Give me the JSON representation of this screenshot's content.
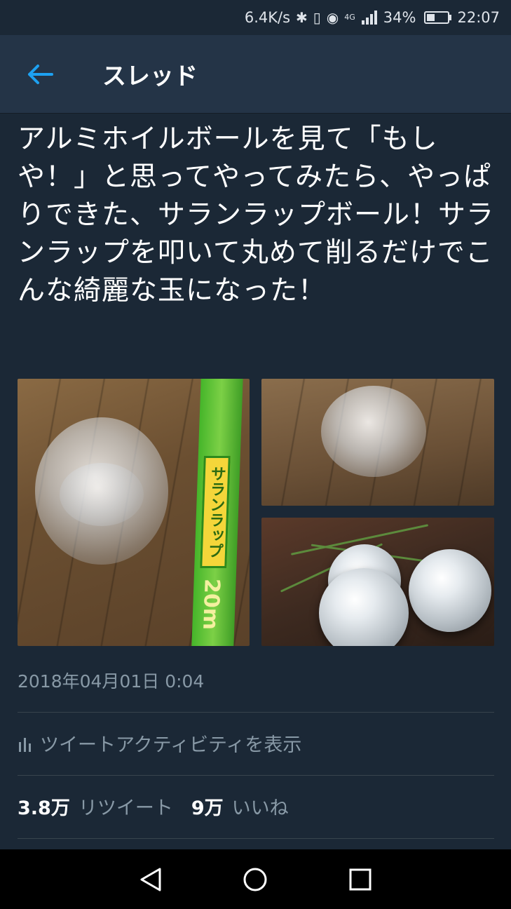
{
  "status_bar": {
    "network_speed": "6.4K/s",
    "network_type": "4G",
    "battery_percent": "34%",
    "time": "22:07"
  },
  "header": {
    "title": "スレッド"
  },
  "tweet": {
    "text": "アルミホイルボールを見て「もしや！」と思ってやってみたら、やっぱりできた、サランラップボール！サランラップを叩いて丸めて削るだけでこんな綺麗な玉になった！",
    "images": [
      {
        "label": "crumpled-wrap-and-box",
        "box_text": "サランラップ",
        "box_length": "20m"
      },
      {
        "label": "wrap-ball-on-floor"
      },
      {
        "label": "clear-wrap-spheres"
      }
    ],
    "timestamp": "2018年04月01日 0:04",
    "activity_label": "ツイートアクティビティを表示",
    "retweet_count": "3.8万",
    "retweet_label": "リツイート",
    "like_count": "9万",
    "like_label": "いいね"
  },
  "colors": {
    "background": "#1b2836",
    "header_bg": "#243447",
    "accent": "#1da1f2",
    "muted_text": "#8899a6",
    "divider": "#38444d"
  },
  "nav": {
    "back": "back-triangle-icon",
    "home": "home-circle-icon",
    "recents": "recents-square-icon"
  }
}
